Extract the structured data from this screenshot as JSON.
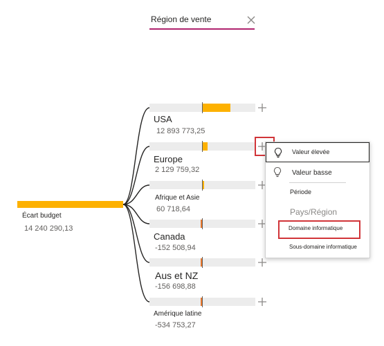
{
  "level_selector": {
    "label": "Région de vente",
    "close_icon": "close-icon"
  },
  "root": {
    "label": "Écart budget",
    "value": "14 240 290,13",
    "bar_color": "#fdb100"
  },
  "nodes": [
    {
      "label": "USA",
      "value": "12 893 773,25",
      "fill_fraction": 0.52,
      "fill_color": "#fdb100",
      "direction": "positive"
    },
    {
      "label": "Europe",
      "value": "2 129 759,32",
      "fill_fraction": 0.09,
      "fill_color": "#fdb100",
      "direction": "positive"
    },
    {
      "label": "Afrique et  Asie",
      "value": "60 718,64",
      "fill_fraction": 0.0,
      "fill_color": "#fdb100",
      "direction": "positive"
    },
    {
      "label": "Canada",
      "value": "-152 508,94",
      "fill_fraction": 0.0,
      "fill_color": "#e8762b",
      "direction": "negative"
    },
    {
      "label": "Aus et NZ",
      "value": "-156 698,88",
      "fill_fraction": 0.0,
      "fill_color": "#e8762b",
      "direction": "negative"
    },
    {
      "label": "Amérique latine",
      "value": "-534 753,27",
      "fill_fraction": 0.02,
      "fill_color": "#e8762b",
      "direction": "negative"
    }
  ],
  "context_menu": {
    "items": [
      {
        "label": "Valeur élevée",
        "icon": "lightbulb-icon",
        "state": "hovered"
      },
      {
        "label": "Valeur basse",
        "icon": "lightbulb-icon"
      },
      {
        "label": "Période"
      },
      {
        "label": "Pays/Région",
        "state": "disabled"
      },
      {
        "label": "Domaine informatique",
        "state": "highlighted"
      },
      {
        "label": "Sous-domaine informatique"
      }
    ]
  },
  "colors": {
    "accent": "#b0226d",
    "positive": "#fdb100",
    "negative": "#e8762b",
    "highlight_box": "#d13438",
    "track": "#ececec"
  }
}
